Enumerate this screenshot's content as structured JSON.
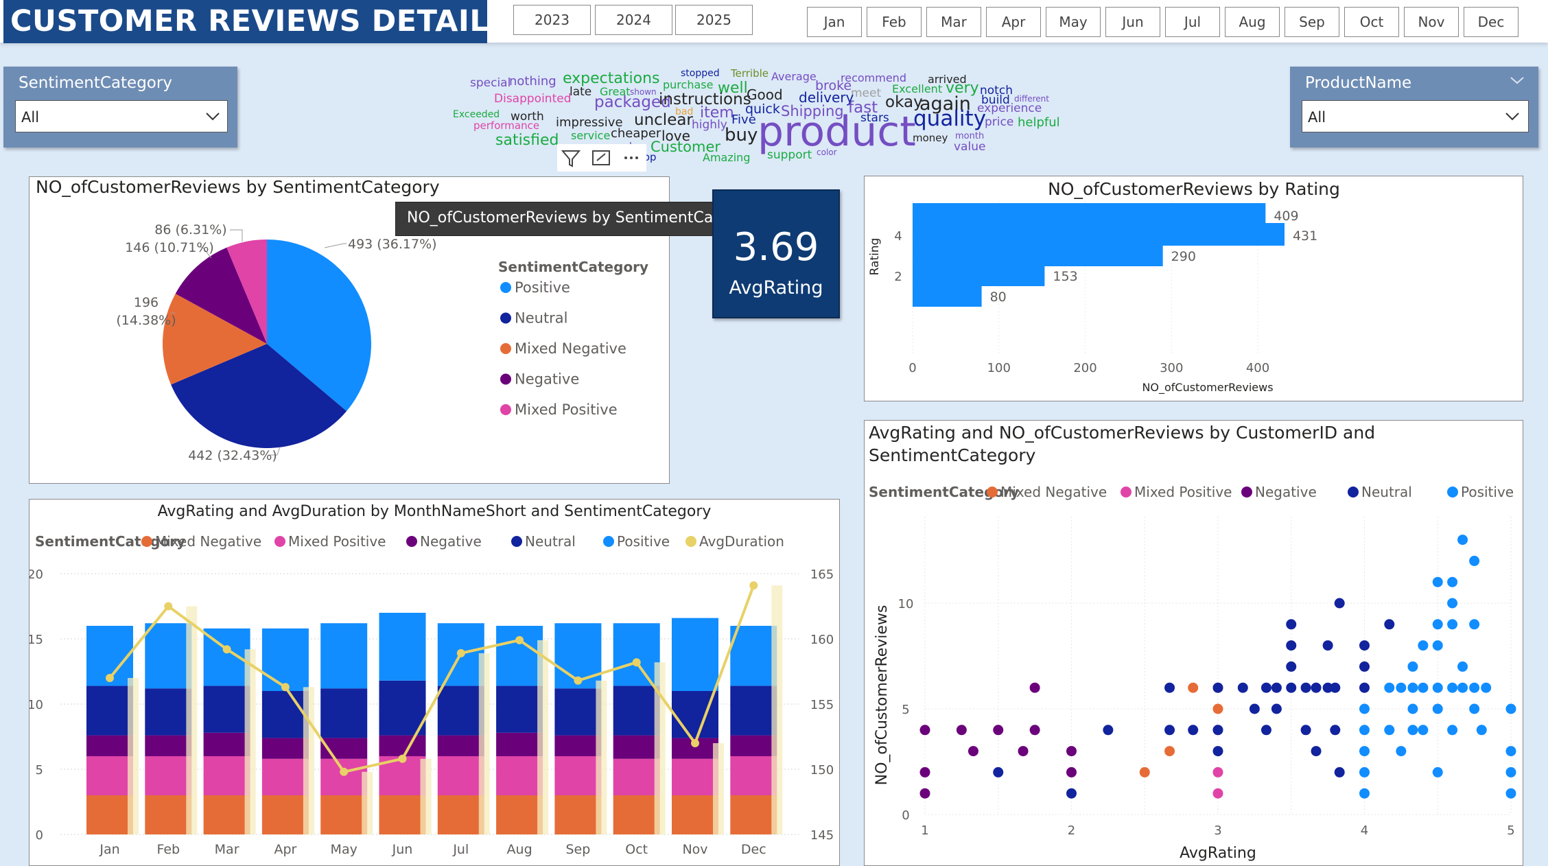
{
  "header": {
    "title": "CUSTOMER REVIEWS DETAILS",
    "years": [
      "2023",
      "2024",
      "2025"
    ],
    "months": [
      "Jan",
      "Feb",
      "Mar",
      "Apr",
      "May",
      "Jun",
      "Jul",
      "Aug",
      "Sep",
      "Oct",
      "Nov",
      "Dec"
    ]
  },
  "slicers": {
    "sentiment": {
      "label": "SentimentCategory",
      "value": "All"
    },
    "product": {
      "label": "ProductName",
      "value": "All"
    }
  },
  "colors": {
    "positive": "#118dff",
    "neutral": "#12239e",
    "mixed_negative": "#e66c37",
    "negative": "#6b007b",
    "mixed_positive": "#e044a7",
    "avg_duration": "#e8d166",
    "title_bg": "#1a4a8a",
    "card_bg": "#0e3b73"
  },
  "wordcloud": {
    "words": [
      {
        "t": "special",
        "c": "#744ec2"
      },
      {
        "t": "nothing",
        "c": "#744ec2"
      },
      {
        "t": "expectations",
        "c": "#1aab40"
      },
      {
        "t": "stopped",
        "c": "#12239e"
      },
      {
        "t": "Terrible",
        "c": "#6b8e23"
      },
      {
        "t": "Average",
        "c": "#744ec2"
      },
      {
        "t": "recommend",
        "c": "#744ec2"
      },
      {
        "t": "arrived",
        "c": "#252423"
      },
      {
        "t": "late",
        "c": "#252423"
      },
      {
        "t": "Great",
        "c": "#1aab40"
      },
      {
        "t": "shown",
        "c": "#744ec2"
      },
      {
        "t": "purchase",
        "c": "#1aab40"
      },
      {
        "t": "well",
        "c": "#1aab40"
      },
      {
        "t": "broke",
        "c": "#744ec2"
      },
      {
        "t": "Excellent",
        "c": "#1aab40"
      },
      {
        "t": "very",
        "c": "#1aab40"
      },
      {
        "t": "notch",
        "c": "#12239e"
      },
      {
        "t": "Disappointed",
        "c": "#e044a7"
      },
      {
        "t": "packaged",
        "c": "#744ec2"
      },
      {
        "t": "instructions",
        "c": "#252423"
      },
      {
        "t": "Good",
        "c": "#252423"
      },
      {
        "t": "meet",
        "c": "#a0a0a0"
      },
      {
        "t": "delivery",
        "c": "#12239e"
      },
      {
        "t": "okay",
        "c": "#252423"
      },
      {
        "t": "again",
        "c": "#252423"
      },
      {
        "t": "build",
        "c": "#12239e"
      },
      {
        "t": "different",
        "c": "#744ec2"
      },
      {
        "t": "Exceeded",
        "c": "#1aab40"
      },
      {
        "t": "worth",
        "c": "#252423"
      },
      {
        "t": "bad",
        "c": "#e8a33c"
      },
      {
        "t": "item",
        "c": "#744ec2"
      },
      {
        "t": "quick",
        "c": "#12239e"
      },
      {
        "t": "Shipping",
        "c": "#744ec2"
      },
      {
        "t": "fast",
        "c": "#744ec2"
      },
      {
        "t": "experience",
        "c": "#744ec2"
      },
      {
        "t": "performance",
        "c": "#e044a7"
      },
      {
        "t": "impressive",
        "c": "#252423"
      },
      {
        "t": "unclear",
        "c": "#252423"
      },
      {
        "t": "Five",
        "c": "#12239e"
      },
      {
        "t": "highly",
        "c": "#744ec2"
      },
      {
        "t": "stars",
        "c": "#12239e"
      },
      {
        "t": "quality",
        "c": "#12239e"
      },
      {
        "t": "price",
        "c": "#744ec2"
      },
      {
        "t": "helpful",
        "c": "#1aab40"
      },
      {
        "t": "service",
        "c": "#1aab40"
      },
      {
        "t": "cheaper",
        "c": "#252423"
      },
      {
        "t": "love",
        "c": "#252423"
      },
      {
        "t": "buy",
        "c": "#252423"
      },
      {
        "t": "product",
        "c": "#744ec2"
      },
      {
        "t": "money",
        "c": "#252423"
      },
      {
        "t": "month",
        "c": "#744ec2"
      },
      {
        "t": "satisfied",
        "c": "#1aab40"
      },
      {
        "t": "working",
        "c": "#744ec2"
      },
      {
        "t": "week",
        "c": "#744ec2"
      },
      {
        "t": "Customer",
        "c": "#1aab40"
      },
      {
        "t": "top",
        "c": "#12239e"
      },
      {
        "t": "Amazing",
        "c": "#1aab40"
      },
      {
        "t": "support",
        "c": "#1aab40"
      },
      {
        "t": "color",
        "c": "#744ec2"
      },
      {
        "t": "value",
        "c": "#744ec2"
      }
    ]
  },
  "pie": {
    "title": "NO_ofCustomerReviews by SentimentCategory",
    "tooltip": "NO_ofCustomerReviews by SentimentCategory",
    "legend_title": "SentimentCategory",
    "legend": [
      "Positive",
      "Neutral",
      "Mixed Negative",
      "Negative",
      "Mixed Positive"
    ],
    "labels": {
      "positive": "493 (36.17%)",
      "neutral": "442 (32.43%)",
      "mixed_negative_1": "196",
      "mixed_negative_2": "(14.38%)",
      "negative": "146 (10.71%)",
      "mixed_positive": "86 (6.31%)"
    }
  },
  "kpi": {
    "value": "3.69",
    "label": "AvgRating"
  },
  "combo": {
    "title": "AvgRating and AvgDuration by MonthNameShort and SentimentCategory",
    "legend_title": "SentimentCategory",
    "legend": [
      "Mixed Negative",
      "Mixed Positive",
      "Negative",
      "Neutral",
      "Positive",
      "AvgDuration"
    ]
  },
  "scatter": {
    "title_line1": "AvgRating and NO_ofCustomerReviews by CustomerID and",
    "title_line2": "SentimentCategory",
    "legend_title": "SentimentCategory",
    "legend": [
      "Mixed Negative",
      "Mixed Positive",
      "Negative",
      "Neutral",
      "Positive"
    ]
  },
  "chart_data": [
    {
      "type": "pie",
      "title": "NO_ofCustomerReviews by SentimentCategory",
      "categories": [
        "Positive",
        "Neutral",
        "Mixed Negative",
        "Negative",
        "Mixed Positive"
      ],
      "values": [
        493,
        442,
        196,
        146,
        86
      ],
      "percents": [
        36.17,
        32.43,
        14.38,
        10.71,
        6.31
      ],
      "legend": "right"
    },
    {
      "type": "bar",
      "orientation": "horizontal",
      "title": "NO_ofCustomerReviews by Rating",
      "xlabel": "NO_ofCustomerReviews",
      "ylabel": "Rating",
      "categories": [
        5,
        4,
        3,
        2,
        1
      ],
      "values": [
        409,
        431,
        290,
        153,
        80
      ],
      "xlim": [
        0,
        470
      ],
      "x_ticks": [
        0,
        100,
        200,
        300,
        400
      ],
      "y_ticks": [
        4,
        2
      ]
    },
    {
      "type": "bar",
      "stacked": true,
      "title": "AvgRating and AvgDuration by MonthNameShort and SentimentCategory",
      "categories": [
        "Jan",
        "Feb",
        "Mar",
        "Apr",
        "May",
        "Jun",
        "Jul",
        "Aug",
        "Sep",
        "Oct",
        "Nov",
        "Dec"
      ],
      "series": [
        {
          "name": "Mixed Negative",
          "values": [
            3,
            3,
            3,
            3,
            3,
            3,
            3,
            3,
            3,
            3,
            3,
            3
          ]
        },
        {
          "name": "Mixed Positive",
          "values": [
            3,
            3,
            3,
            2.8,
            2.8,
            3,
            3,
            3,
            3,
            2.8,
            2.8,
            3
          ]
        },
        {
          "name": "Negative",
          "values": [
            1.6,
            1.6,
            1.8,
            1.6,
            1.6,
            1.6,
            1.6,
            1.8,
            1.6,
            1.8,
            1.6,
            1.6
          ]
        },
        {
          "name": "Neutral",
          "values": [
            3.8,
            3.6,
            3.6,
            3.6,
            3.8,
            4.2,
            3.8,
            3.6,
            3.6,
            3.8,
            3.6,
            3.8
          ]
        },
        {
          "name": "Positive",
          "values": [
            4.6,
            5,
            4.4,
            4.8,
            5,
            5.2,
            4.8,
            4.6,
            5,
            4.8,
            5.6,
            4.6
          ]
        }
      ],
      "line": {
        "name": "AvgDuration",
        "values": [
          157.0,
          162.5,
          159.2,
          156.3,
          149.8,
          150.8,
          158.9,
          159.9,
          156.8,
          158.2,
          152.0,
          164.1
        ]
      },
      "ylim_left": [
        0,
        20
      ],
      "ylim_right": [
        145,
        165
      ],
      "y_ticks_left": [
        0,
        5,
        10,
        15,
        20
      ],
      "y_ticks_right": [
        145,
        150,
        155,
        160,
        165
      ],
      "legend": "top"
    },
    {
      "type": "scatter",
      "title": "AvgRating and NO_ofCustomerReviews by CustomerID and SentimentCategory",
      "xlabel": "AvgRating",
      "ylabel": "NO_ofCustomerReviews",
      "xlim": [
        1,
        5
      ],
      "ylim": [
        0,
        14
      ],
      "x_ticks": [
        1,
        2,
        3,
        4,
        5
      ],
      "y_ticks": [
        0,
        5,
        10
      ],
      "legend": "top",
      "series": [
        {
          "name": "Mixed Negative",
          "points": [
            [
              2.5,
              2
            ],
            [
              2.67,
              3
            ],
            [
              2.83,
              6
            ],
            [
              3,
              6
            ],
            [
              3,
              5
            ]
          ]
        },
        {
          "name": "Mixed Positive",
          "points": [
            [
              3,
              4
            ],
            [
              3,
              2
            ],
            [
              3,
              1
            ]
          ]
        },
        {
          "name": "Negative",
          "points": [
            [
              1,
              4
            ],
            [
              1,
              2
            ],
            [
              1,
              1
            ],
            [
              1.25,
              4
            ],
            [
              1.33,
              3
            ],
            [
              1.5,
              4
            ],
            [
              1.67,
              3
            ],
            [
              1.75,
              6
            ],
            [
              1.75,
              4
            ],
            [
              2,
              3
            ],
            [
              2,
              2
            ]
          ]
        },
        {
          "name": "Neutral",
          "points": [
            [
              1.5,
              2
            ],
            [
              2,
              1
            ],
            [
              2.25,
              4
            ],
            [
              2.67,
              4
            ],
            [
              2.83,
              4
            ],
            [
              3,
              6
            ],
            [
              3,
              4
            ],
            [
              3,
              3
            ],
            [
              3.17,
              6
            ],
            [
              3.25,
              5
            ],
            [
              3.33,
              6
            ],
            [
              3.33,
              4
            ],
            [
              3.4,
              6
            ],
            [
              3.4,
              5
            ],
            [
              3.5,
              6
            ],
            [
              3.5,
              7
            ],
            [
              3.5,
              8
            ],
            [
              3.5,
              9
            ],
            [
              3.6,
              6
            ],
            [
              3.6,
              4
            ],
            [
              3.67,
              6
            ],
            [
              3.67,
              3
            ],
            [
              3.75,
              6
            ],
            [
              3.75,
              8
            ],
            [
              3.8,
              6
            ],
            [
              3.8,
              4
            ],
            [
              3.83,
              10
            ],
            [
              3.83,
              2
            ],
            [
              4,
              6
            ],
            [
              4,
              7
            ],
            [
              4,
              8
            ],
            [
              2.67,
              6
            ],
            [
              4.17,
              9
            ]
          ]
        },
        {
          "name": "Positive",
          "points": [
            [
              4,
              5
            ],
            [
              4,
              4
            ],
            [
              4,
              3
            ],
            [
              4,
              2
            ],
            [
              4,
              1
            ],
            [
              4.17,
              6
            ],
            [
              4.17,
              4
            ],
            [
              4.25,
              6
            ],
            [
              4.25,
              3
            ],
            [
              4.33,
              7
            ],
            [
              4.33,
              6
            ],
            [
              4.33,
              5
            ],
            [
              4.4,
              8
            ],
            [
              4.4,
              6
            ],
            [
              4.4,
              4
            ],
            [
              4.5,
              11
            ],
            [
              4.5,
              9
            ],
            [
              4.5,
              8
            ],
            [
              4.5,
              6
            ],
            [
              4.5,
              5
            ],
            [
              4.5,
              2
            ],
            [
              4.6,
              11
            ],
            [
              4.6,
              10
            ],
            [
              4.6,
              9
            ],
            [
              4.6,
              6
            ],
            [
              4.6,
              4
            ],
            [
              4.67,
              13
            ],
            [
              4.67,
              7
            ],
            [
              4.67,
              6
            ],
            [
              4.75,
              12
            ],
            [
              4.75,
              9
            ],
            [
              4.75,
              6
            ],
            [
              4.75,
              5
            ],
            [
              4.8,
              4
            ],
            [
              4.83,
              6
            ],
            [
              5,
              5
            ],
            [
              5,
              3
            ],
            [
              5,
              2
            ],
            [
              5,
              1
            ],
            [
              4.33,
              4
            ]
          ]
        }
      ]
    }
  ]
}
